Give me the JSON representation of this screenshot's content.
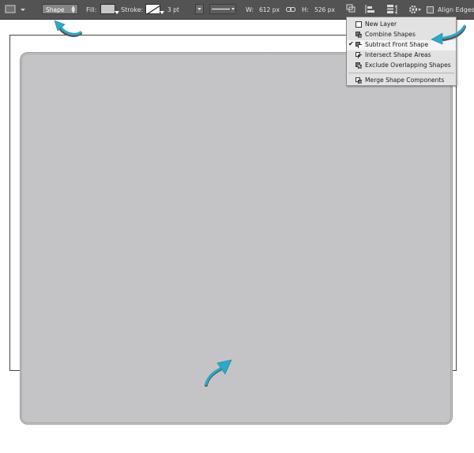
{
  "toolbar": {
    "mode": "Shape",
    "fill_label": "Fill:",
    "stroke_label": "Stroke:",
    "stroke_size": "3 pt",
    "width_label": "W:",
    "width_value": "612 px",
    "height_label": "H:",
    "height_value": "526 px",
    "align_edges_label": "Align Edges",
    "fill_color": "#c7c7c9"
  },
  "path_operations_menu": {
    "items": [
      {
        "label": "New Layer",
        "icon": "new-layer-icon",
        "checked": false
      },
      {
        "label": "Combine Shapes",
        "icon": "combine-shapes-icon",
        "checked": false
      },
      {
        "label": "Subtract Front Shape",
        "icon": "subtract-front-shape-icon",
        "checked": true
      },
      {
        "label": "Intersect Shape Areas",
        "icon": "intersect-shape-areas-icon",
        "checked": false
      },
      {
        "label": "Exclude Overlapping Shapes",
        "icon": "exclude-overlapping-shapes-icon",
        "checked": false
      },
      {
        "label": "Merge Shape Components",
        "icon": "merge-shape-components-icon",
        "checked": false
      }
    ]
  },
  "annotation_color": "#2aa9c9"
}
